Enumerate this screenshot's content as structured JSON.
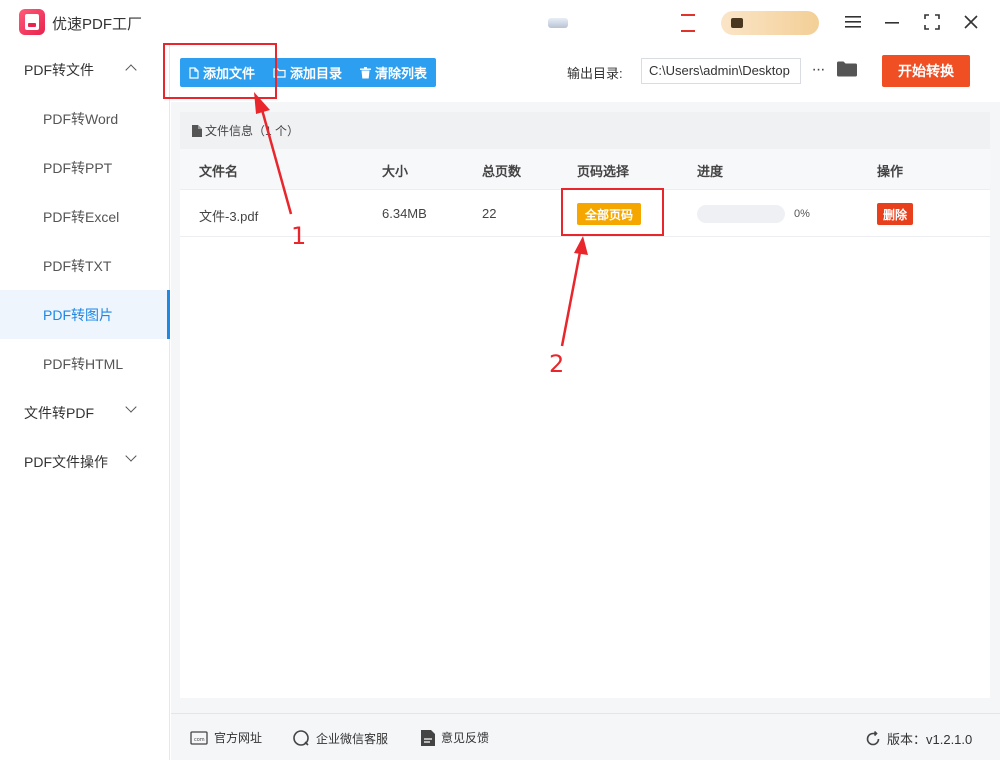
{
  "app": {
    "title": "优速PDF工厂"
  },
  "sidebar": {
    "groups": [
      {
        "label": "PDF转文件",
        "expanded": true
      },
      {
        "label": "文件转PDF",
        "expanded": false
      },
      {
        "label": "PDF文件操作",
        "expanded": false
      }
    ],
    "items": [
      {
        "label": "PDF转Word"
      },
      {
        "label": "PDF转PPT"
      },
      {
        "label": "PDF转Excel"
      },
      {
        "label": "PDF转TXT"
      },
      {
        "label": "PDF转图片",
        "active": true
      },
      {
        "label": "PDF转HTML"
      }
    ]
  },
  "toolbar": {
    "add_file": "添加文件",
    "add_dir": "添加目录",
    "clear_list": "清除列表",
    "output_label": "输出目录:",
    "output_path": "C:\\Users\\admin\\Desktop",
    "more": "···",
    "start": "开始转换"
  },
  "file_panel": {
    "header_label": "文件信息",
    "header_count": "（1 个）",
    "columns": [
      "文件名",
      "大小",
      "总页数",
      "页码选择",
      "进度",
      "操作"
    ],
    "rows": [
      {
        "name": "文件-3.pdf",
        "size": "6.34MB",
        "pages": "22",
        "page_select": "全部页码",
        "progress": 0,
        "progress_text": "0%",
        "action": "删除"
      }
    ]
  },
  "footer": {
    "website": "官方网址",
    "wechat": "企业微信客服",
    "feedback": "意见反馈",
    "version": "版本：v1.2.1.0"
  },
  "annotations": {
    "label_1": "1",
    "label_2": "2",
    "color": "#e8262b"
  },
  "colors": {
    "primary": "#2d9ff0",
    "start": "#f04e23",
    "page_select": "#f5a700",
    "delete": "#e8401c",
    "active_nav": "#1e88e5"
  }
}
